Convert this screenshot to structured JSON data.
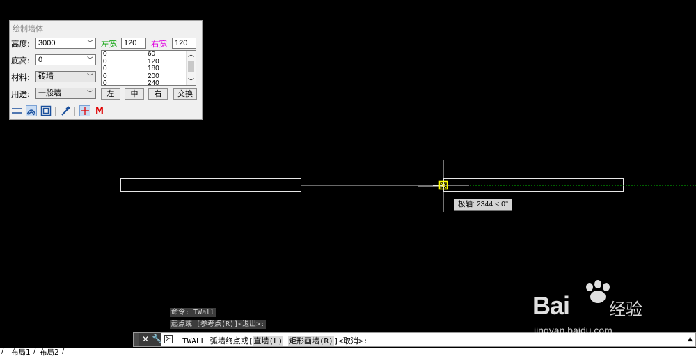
{
  "panel": {
    "title": "绘制墙体",
    "height_label": "高度:",
    "height_value": "3000",
    "base_label": "底高:",
    "base_value": "0",
    "material_label": "材料:",
    "material_value": "砖墙",
    "usage_label": "用途:",
    "usage_value": "一般墙",
    "left_width_label": "左宽",
    "left_width_value": "120",
    "right_width_label": "右宽",
    "right_width_value": "120",
    "width_list": [
      {
        "left": "0",
        "right": "60"
      },
      {
        "left": "0",
        "right": "120"
      },
      {
        "left": "0",
        "right": "180"
      },
      {
        "left": "0",
        "right": "200"
      },
      {
        "left": "0",
        "right": "240"
      }
    ],
    "buttons": {
      "left": "左",
      "center": "中",
      "right": "右",
      "swap": "交换"
    },
    "toolbar_m": "M",
    "colors": {
      "left_width": "#00a000",
      "right_width": "#e000e0",
      "m": "#e00000"
    }
  },
  "tooltip": "极轴: 2344 < 0°",
  "command": {
    "history": [
      "命令: TWall",
      "起点或 [参考点(R)]<退出>:"
    ],
    "prompt_prefix": "TWALL 弧墙终点或[",
    "opt1": "直墙(L)",
    "opt2": "矩形画墙(R)",
    "prompt_suffix": "]<取消>:"
  },
  "tabs": [
    "布局1",
    "布局2"
  ],
  "watermark": {
    "brand": "Bai",
    "text": "经验",
    "url": "jingyan.baidu.com"
  },
  "colors": {
    "background": "#000000",
    "cursor": "#ffff00",
    "tracking": "#00c000"
  }
}
